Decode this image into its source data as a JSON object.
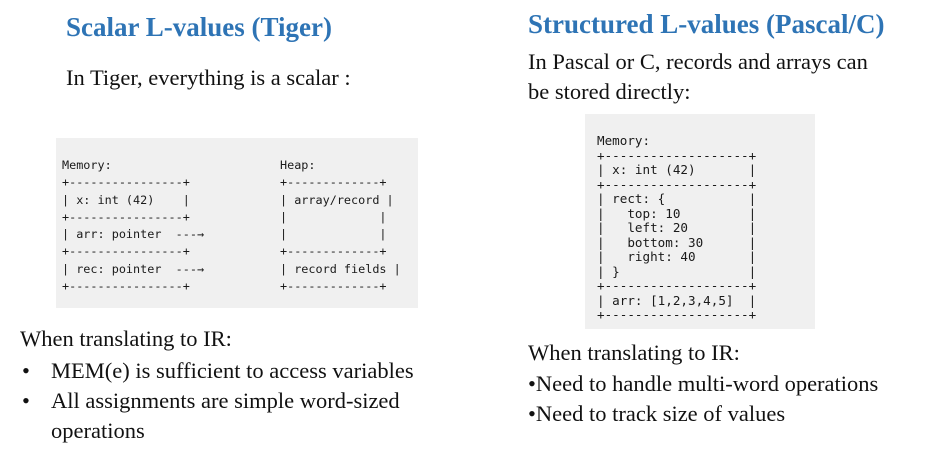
{
  "left": {
    "title": "Scalar L-values (Tiger)",
    "intro": "In Tiger, everything is a scalar :",
    "memory_diagram": "Memory:\n+----------------+\n| x: int (42)    |\n+----------------+\n| arr: pointer  ---→\n+----------------+\n| rec: pointer  ---→\n+----------------+",
    "heap_diagram": "Heap:\n+-------------+\n| array/record |\n|             |\n|             |\n+-------------+\n| record fields |\n+-------------+",
    "ir_heading": "When translating to IR:",
    "bullets": [
      "MEM(e) is sufficient to access variables",
      "All assignments are simple word-sized",
      "operations"
    ]
  },
  "right": {
    "title": "Structured L-values (Pascal/C)",
    "intro_line1": "In Pascal or C, records and arrays can",
    "intro_line2": "be stored directly:",
    "memory_diagram": "Memory:\n+-------------------+\n| x: int (42)       |\n+-------------------+\n| rect: {           |\n|   top: 10         |\n|   left: 20        |\n|   bottom: 30      |\n|   right: 40       |\n| }                 |\n+-------------------+\n| arr: [1,2,3,4,5]  |\n+-------------------+",
    "ir_heading": "When translating to IR:",
    "points": [
      "•Need to handle multi-word operations",
      "•Need to track size of values"
    ]
  },
  "bullet_glyph": "•",
  "colors": {
    "title": "#2e74b5",
    "code_bg": "#f0f0f0"
  }
}
